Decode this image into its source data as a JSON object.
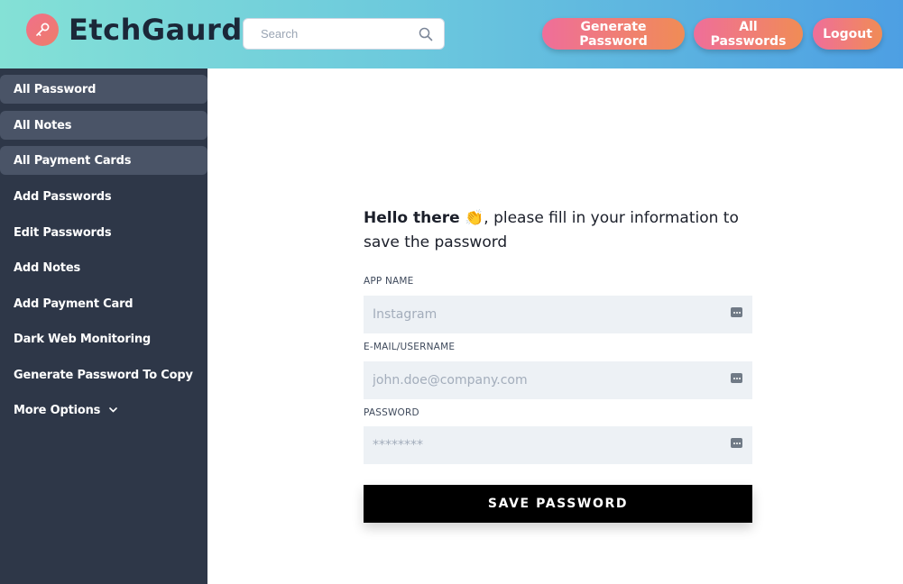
{
  "header": {
    "brand": "EtchGaurd",
    "logo_icon": "key-icon",
    "search": {
      "placeholder": "Search",
      "icon": "search-icon"
    },
    "buttons": {
      "generate_password": "Generate Password",
      "all_passwords": "All Passwords",
      "logout": "Logout"
    },
    "colors": {
      "gradient_start": "#84e1d6",
      "gradient_end": "#4d9fe3",
      "pill_start": "#ef6e9a",
      "pill_end": "#f08c55"
    }
  },
  "sidebar": {
    "items": [
      {
        "label": "All Password",
        "highlighted": true
      },
      {
        "label": "All Notes",
        "highlighted": true
      },
      {
        "label": "All Payment Cards",
        "highlighted": true
      },
      {
        "label": "Add Passwords",
        "highlighted": false
      },
      {
        "label": "Edit Passwords",
        "highlighted": false
      },
      {
        "label": "Add Notes",
        "highlighted": false
      },
      {
        "label": "Add Payment Card",
        "highlighted": false
      },
      {
        "label": "Dark Web Monitoring",
        "highlighted": false
      },
      {
        "label": "Generate Password To Copy",
        "highlighted": false
      },
      {
        "label": "More Options",
        "highlighted": false,
        "icon": "chevron-down-icon"
      }
    ]
  },
  "form": {
    "greeting_bold": "Hello there",
    "greeting_emoji": "👏",
    "greeting_rest": ", please fill in your information to save the password",
    "app_name": {
      "label": "APP NAME",
      "placeholder": "Instagram",
      "icon": "keyboard-icon"
    },
    "email": {
      "label": "E-MAIL/USERNAME",
      "placeholder": "john.doe@company.com",
      "icon": "keyboard-icon"
    },
    "password": {
      "label": "PASSWORD",
      "placeholder": "********",
      "icon": "keyboard-icon"
    },
    "save_label": "SAVE PASSWORD"
  }
}
